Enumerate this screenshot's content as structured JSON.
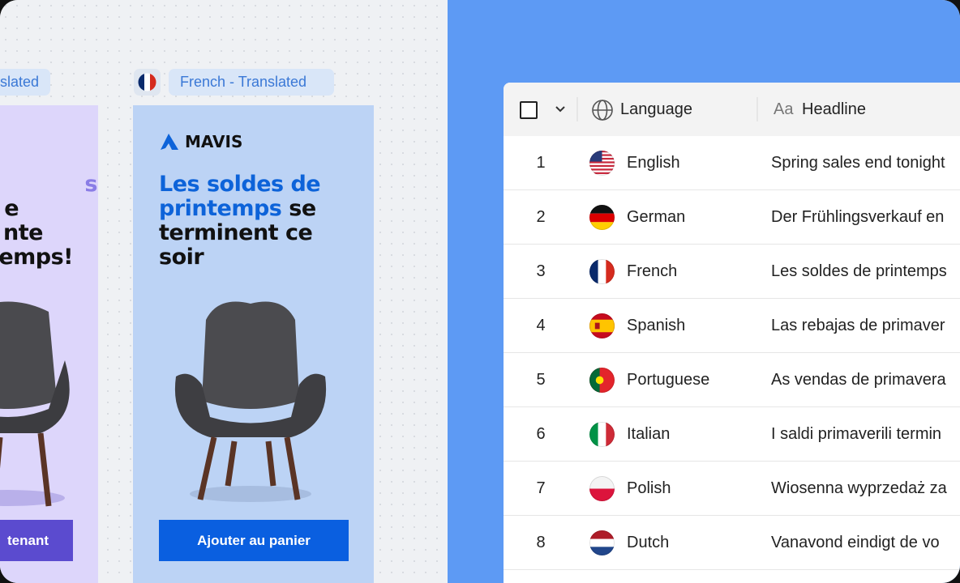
{
  "left_panel": {
    "prev_chip": "slated",
    "prev_headline": [
      "s",
      "e",
      "nte",
      "emps!"
    ],
    "prev_cta": "tenant",
    "flag_icon": "france-flag-icon",
    "chip": "French - Translated",
    "brand": "MAVIS",
    "headline_blue_1": "Les soldes de",
    "headline_blue_2": "printemps",
    "headline_rest_2": " se",
    "headline_3": "terminent ce",
    "headline_4": "soir",
    "cta": "Ajouter au panier",
    "colors": {
      "accent": "#0d63d9",
      "prev_accent": "#5b4bcf",
      "banner": "#bcd3f5",
      "prev_banner": "#ddd6fb",
      "right_bg": "#5d9af4"
    }
  },
  "table": {
    "columns": {
      "language": "Language",
      "headline": "Headline",
      "headline_icon": "Aa"
    },
    "rows": [
      {
        "n": "1",
        "flag": "us",
        "language": "English",
        "headline": "Spring sales end tonight"
      },
      {
        "n": "2",
        "flag": "de",
        "language": "German",
        "headline": "Der Frühlingsverkauf en"
      },
      {
        "n": "3",
        "flag": "fr",
        "language": "French",
        "headline": "Les soldes de printemps"
      },
      {
        "n": "4",
        "flag": "es",
        "language": "Spanish",
        "headline": "Las rebajas de primaver"
      },
      {
        "n": "5",
        "flag": "pt",
        "language": "Portuguese",
        "headline": "As vendas de primavera"
      },
      {
        "n": "6",
        "flag": "it",
        "language": "Italian",
        "headline": "I saldi primaverili termin"
      },
      {
        "n": "7",
        "flag": "pl",
        "language": "Polish",
        "headline": "Wiosenna wyprzedaż za"
      },
      {
        "n": "8",
        "flag": "nl",
        "language": "Dutch",
        "headline": "Vanavond eindigt de vo"
      }
    ]
  }
}
